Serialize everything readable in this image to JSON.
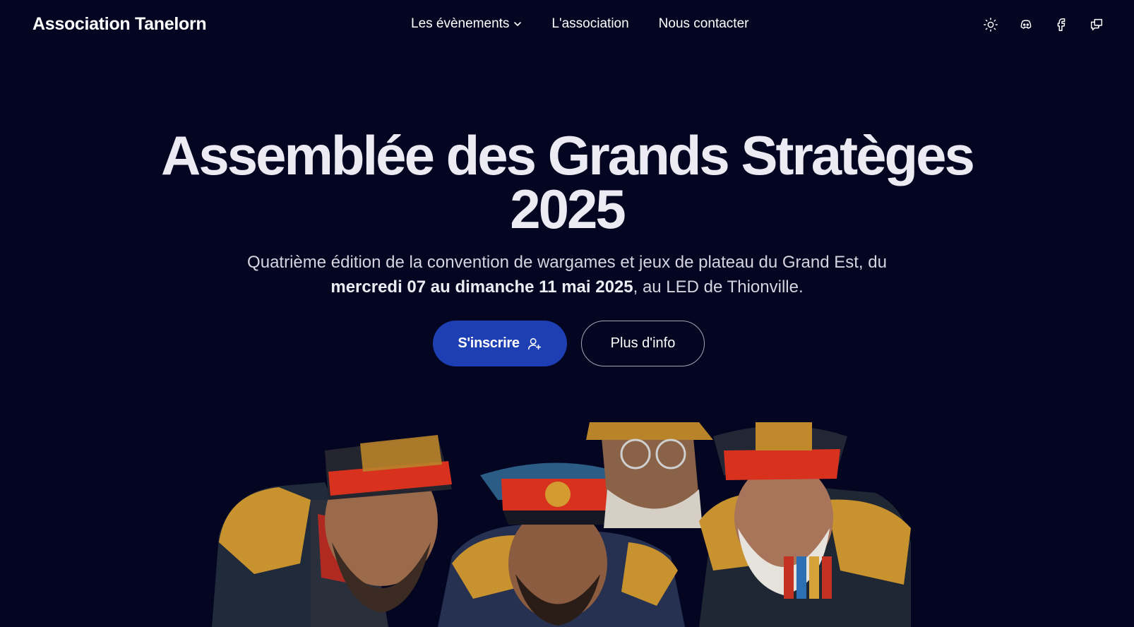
{
  "header": {
    "brand": "Association Tanelorn",
    "nav": [
      {
        "label": "Les évènements",
        "has_dropdown": true
      },
      {
        "label": "L'association"
      },
      {
        "label": "Nous contacter"
      }
    ],
    "icons": [
      "sun-icon",
      "discord-icon",
      "facebook-icon",
      "chat-icon"
    ]
  },
  "hero": {
    "title_line1": "Assemblée des Grands Stratèges",
    "title_line2": "2025",
    "subtitle_part1": "Quatrième édition de la convention de wargames et jeux de plateau du Grand Est, du",
    "subtitle_bold": "mercredi 07 au dimanche 11 mai 2025",
    "subtitle_part2": ", au LED de Thionville.",
    "primary_button": "S'inscrire",
    "secondary_button": "Plus d'info"
  },
  "colors": {
    "background": "#030521",
    "primary": "#1e3fb3",
    "text": "#eceaf2"
  }
}
